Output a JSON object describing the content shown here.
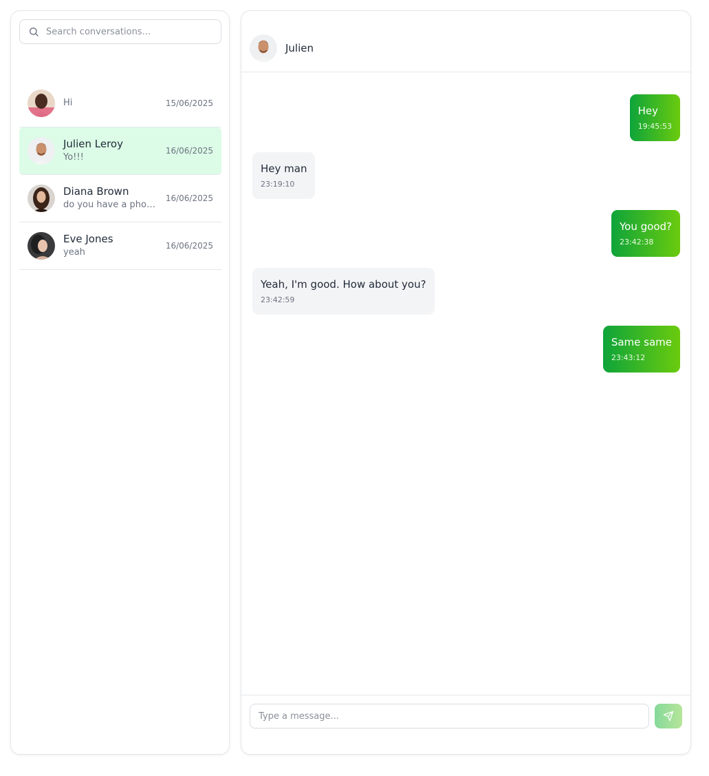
{
  "search": {
    "placeholder": "Search conversations..."
  },
  "conversations": [
    {
      "name": "",
      "preview": "Hi",
      "date": "15/06/2025",
      "active": false
    },
    {
      "name": "Julien Leroy",
      "preview": "Yo!!!",
      "date": "16/06/2025",
      "active": true
    },
    {
      "name": "Diana Brown",
      "preview": "do you have a phone ...",
      "date": "16/06/2025",
      "active": false
    },
    {
      "name": "Eve Jones",
      "preview": "yeah",
      "date": "16/06/2025",
      "active": false
    }
  ],
  "chat": {
    "title": "Julien",
    "messages": [
      {
        "from": "me",
        "text": "Hey",
        "time": "19:45:53"
      },
      {
        "from": "them",
        "text": "Hey man",
        "time": "23:19:10"
      },
      {
        "from": "me",
        "text": "You good?",
        "time": "23:42:38"
      },
      {
        "from": "them",
        "text": "Yeah, I'm good. How about you?",
        "time": "23:42:59"
      },
      {
        "from": "me",
        "text": "Same same",
        "time": "23:43:12"
      }
    ]
  },
  "composer": {
    "placeholder": "Type a message..."
  },
  "colors": {
    "active_conversation": "#dcfce7",
    "own_bubble_start": "#0ea43a",
    "own_bubble_end": "#6bcb0e",
    "their_bubble": "#f3f4f6"
  },
  "icons": {
    "search": "search-icon",
    "send": "send-icon"
  }
}
